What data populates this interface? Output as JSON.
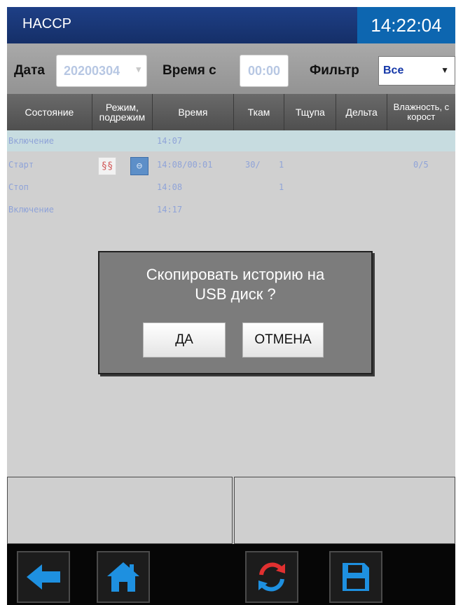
{
  "header": {
    "title": "HACCP",
    "clock": "14:22:04"
  },
  "filters": {
    "date_label": "Дата",
    "date_value": "20200304",
    "time_label": "Время с",
    "time_value": "00:00",
    "filter_label": "Фильтр",
    "filter_value": "Все"
  },
  "table": {
    "columns": [
      "Состояние",
      "Режим, подрежим",
      "Время",
      "Ткам",
      "Тщупа",
      "Дельта",
      "Влажность, скорост"
    ],
    "rows": [
      {
        "state": "Включение",
        "time": "14:07",
        "tcam": "",
        "tprobe": "",
        "extra": "",
        "selected": true,
        "icons": false
      },
      {
        "state": "Старт",
        "time": "14:08/00:01",
        "tcam": "30/",
        "tprobe": "1",
        "extra": "0/5",
        "selected": false,
        "icons": true
      },
      {
        "state": "Стоп",
        "time": "14:08",
        "tcam": "",
        "tprobe": "1",
        "extra": "",
        "selected": false,
        "icons": false
      },
      {
        "state": "Включение",
        "time": "14:17",
        "tcam": "",
        "tprobe": "",
        "extra": "",
        "selected": false,
        "icons": false
      }
    ]
  },
  "dialog": {
    "line1": "Скопировать историю на",
    "line2": "USB диск ?",
    "yes_label": "ДА",
    "cancel_label": "ОТМЕНА"
  },
  "icons": {
    "heat": "heat-waves-icon",
    "fan": "fan-mode-icon",
    "back": "arrow-left-icon",
    "home": "home-icon",
    "refresh": "refresh-icon",
    "save": "floppy-disk-icon"
  },
  "colors": {
    "title_bar": "#1e3f86",
    "clock_bg": "#0d66b0",
    "selected_row": "#c7dce0",
    "row_text": "#8fa3d8",
    "icon_blue": "#1e90e0",
    "refresh_red": "#e03030"
  }
}
